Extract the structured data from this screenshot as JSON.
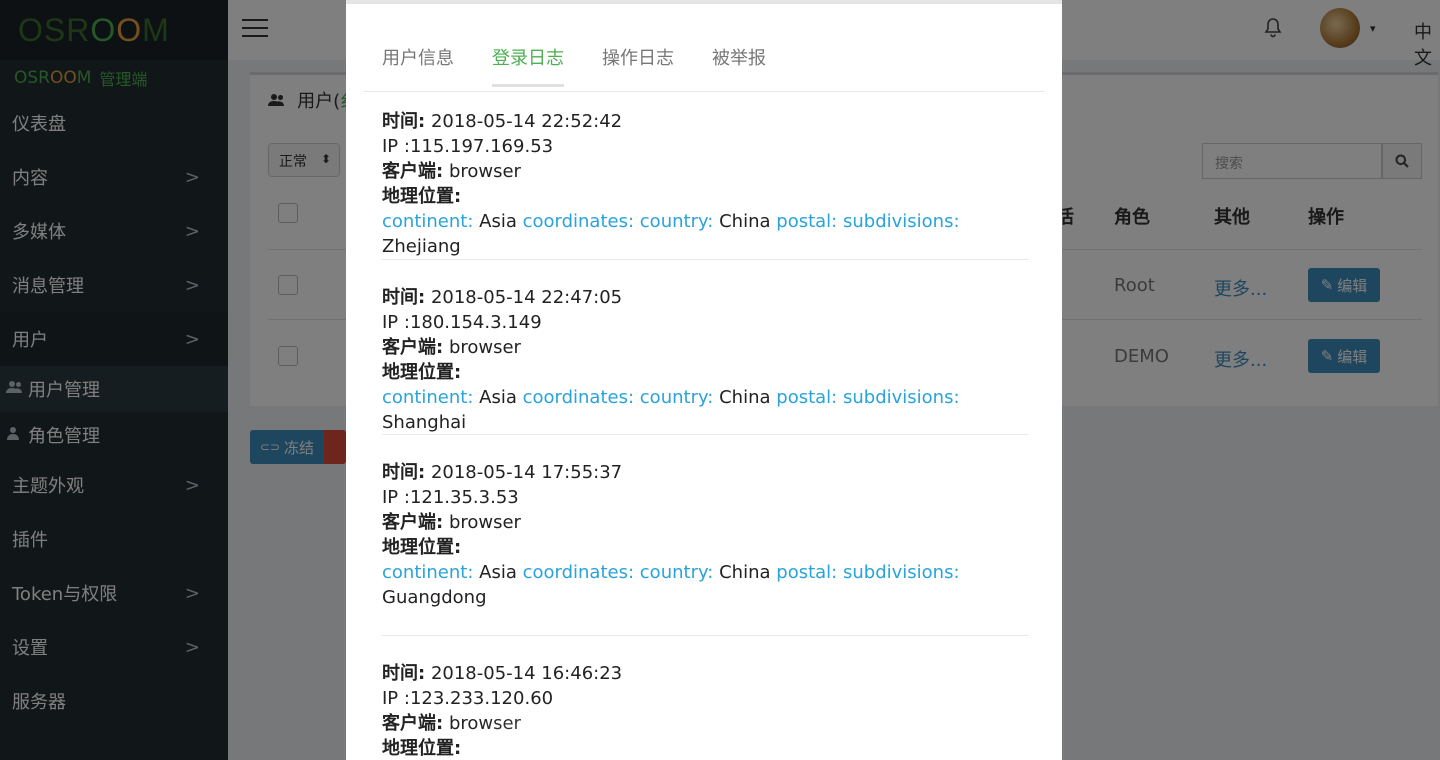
{
  "sidebar": {
    "logo": {
      "pre": "OSR",
      "o1": "O",
      "o2": "O",
      "post": "M"
    },
    "sub_logo": {
      "pre": "OSR",
      "oo": "OO",
      "post": "M",
      "admin": "管理端"
    },
    "items": [
      {
        "label": "仪表盘"
      },
      {
        "label": "内容",
        "chevron": ">"
      },
      {
        "label": "多媒体",
        "chevron": ">"
      },
      {
        "label": "消息管理",
        "chevron": ">"
      },
      {
        "label": "用户",
        "chevron": ">"
      }
    ],
    "sub_items": [
      {
        "label": "用户管理"
      },
      {
        "label": "角色管理"
      }
    ],
    "items2": [
      {
        "label": "主题外观",
        "chevron": ">"
      },
      {
        "label": "插件"
      },
      {
        "label": "Token与权限",
        "chevron": ">"
      },
      {
        "label": "设置",
        "chevron": ">"
      },
      {
        "label": "服务器"
      }
    ]
  },
  "header": {
    "lang": "中文",
    "avatar_caret": "▾",
    "bell_icon": "bell-icon"
  },
  "box": {
    "title": "用户(",
    "title_cut": "纟",
    "status_select": "正常",
    "status_arrow": "⬍",
    "search_placeholder": "搜索",
    "columns": {
      "active": "活",
      "role": "角色",
      "other": "其他",
      "action": "操作"
    },
    "rows": [
      {
        "role": "Root",
        "more": "更多...",
        "edit": "编辑"
      },
      {
        "role": "DEMO",
        "more": "更多...",
        "edit": "编辑"
      }
    ],
    "freeze_label": "冻结",
    "freeze_icon": "⊂⊃"
  },
  "modal": {
    "tabs": [
      {
        "label": "用户信息",
        "active": false
      },
      {
        "label": "登录日志",
        "active": true
      },
      {
        "label": "操作日志",
        "active": false
      },
      {
        "label": "被举报",
        "active": false
      }
    ],
    "labels": {
      "time": "时间:",
      "ip": "IP :",
      "client": "客户端:",
      "geo": "地理位置:",
      "continent": "continent:",
      "coordinates": "coordinates:",
      "country": "country:",
      "postal": "postal:",
      "subdivisions": "subdivisions:"
    },
    "entries": [
      {
        "time": "2018-05-14 22:52:42",
        "ip": "115.197.169.53",
        "client": "browser",
        "continent": "Asia",
        "country": "China",
        "subdivision": "Zhejiang"
      },
      {
        "time": "2018-05-14 22:47:05",
        "ip": "180.154.3.149",
        "client": "browser",
        "continent": "Asia",
        "country": "China",
        "subdivision": "Shanghai"
      },
      {
        "time": "2018-05-14 17:55:37",
        "ip": "121.35.3.53",
        "client": "browser",
        "continent": "Asia",
        "country": "China",
        "subdivision": "Guangdong"
      },
      {
        "time": "2018-05-14 16:46:23",
        "ip": "123.233.120.60",
        "client": "browser"
      }
    ]
  }
}
